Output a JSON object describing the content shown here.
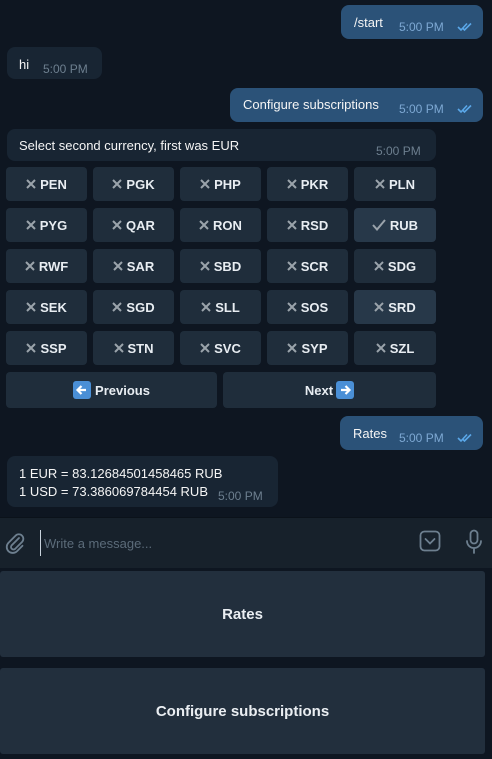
{
  "messages": [
    {
      "text": "/start",
      "time": "5:00 PM"
    },
    {
      "text": "hi",
      "time": "5:00 PM"
    },
    {
      "text": "Configure subscriptions",
      "time": "5:00 PM"
    },
    {
      "text": "Select second currency, first was EUR",
      "time": "5:00 PM"
    },
    {
      "text": "Rates",
      "time": "5:00 PM"
    },
    {
      "line1": "1 EUR = 83.12684501458465 RUB",
      "line2": "1 USD = 73.386069784454 RUB",
      "time": "5:00 PM"
    }
  ],
  "keyboard": {
    "rows": [
      [
        "PEN",
        "PGK",
        "PHP",
        "PKR",
        "PLN"
      ],
      [
        "PYG",
        "QAR",
        "RON",
        "RSD",
        "RUB"
      ],
      [
        "RWF",
        "SAR",
        "SBD",
        "SCR",
        "SDG"
      ],
      [
        "SEK",
        "SGD",
        "SLL",
        "SOS",
        "SRD"
      ],
      [
        "SSP",
        "STN",
        "SVC",
        "SYP",
        "SZL"
      ]
    ],
    "selected": "RUB",
    "previous_label": "Previous",
    "next_label": "Next"
  },
  "composer": {
    "placeholder": "Write a message..."
  },
  "reply_keyboard": {
    "rates": "Rates",
    "configure": "Configure subscriptions"
  },
  "colors": {
    "outgoing": "#2b5278",
    "incoming": "#182533",
    "background": "#0e1621",
    "tick": "#5aa7e8"
  }
}
